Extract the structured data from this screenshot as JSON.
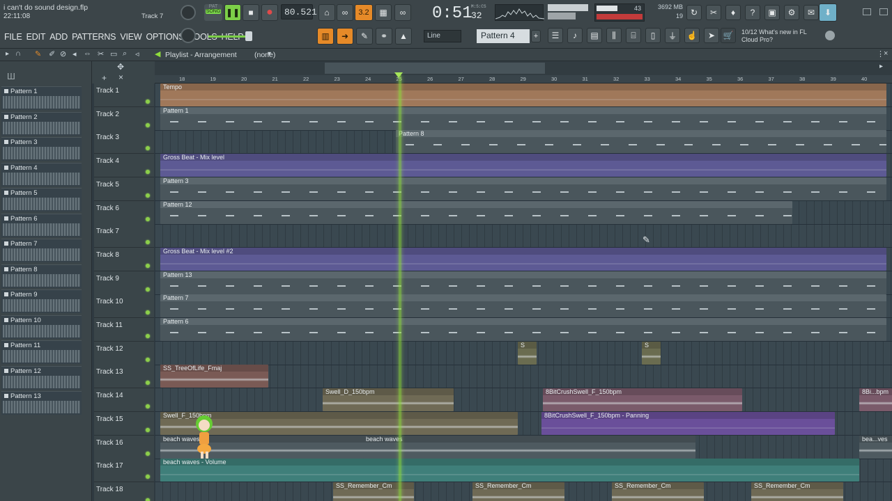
{
  "window": {
    "title": "i can't do sound design.flp",
    "time": "22:11:08",
    "hint_track": "Track 7"
  },
  "transport": {
    "mode": "SONG",
    "pat_label": "PAT",
    "tempo": "80.521",
    "snap": "3.2",
    "song_time": "0:51",
    "song_time_sub": "32",
    "time_unit": "M:S:CS",
    "cpu": "43",
    "ram": "3692 MB",
    "poly": "19"
  },
  "menu": [
    "FILE",
    "EDIT",
    "ADD",
    "PATTERNS",
    "VIEW",
    "OPTIONS",
    "TOOLS",
    "HELP"
  ],
  "toolbar2": {
    "line_mode": "Line",
    "pattern_selector": "Pattern 4",
    "news_count": "10/12",
    "news_text": "What's new in FL Cloud Pro?"
  },
  "playlist": {
    "title": "Playlist - Arrangement",
    "arrangement": "(none)"
  },
  "picker": [
    "Pattern 1",
    "Pattern 2",
    "Pattern 3",
    "Pattern 4",
    "Pattern 5",
    "Pattern 6",
    "Pattern 7",
    "Pattern 8",
    "Pattern 9",
    "Pattern 10",
    "Pattern 11",
    "Pattern 12",
    "Pattern 13"
  ],
  "ruler": [
    "18",
    "19",
    "20",
    "21",
    "22",
    "23",
    "24",
    "25",
    "26",
    "27",
    "28",
    "29",
    "30",
    "31",
    "32",
    "33",
    "34",
    "35",
    "36",
    "37",
    "38",
    "39",
    "40"
  ],
  "tracks": [
    "Track 1",
    "Track 2",
    "Track 3",
    "Track 4",
    "Track 5",
    "Track 6",
    "Track 7",
    "Track 8",
    "Track 9",
    "Track 10",
    "Track 11",
    "Track 12",
    "Track 13",
    "Track 14",
    "Track 15",
    "Track 16",
    "Track 17",
    "Track 18"
  ],
  "clips": [
    {
      "track": 0,
      "label": "Tempo",
      "kind": "auto",
      "color": "#a0785a"
    },
    {
      "track": 1,
      "label": "Pattern 1",
      "kind": "pattern",
      "color": "#5b676d"
    },
    {
      "track": 2,
      "label": "Pattern 8",
      "kind": "pattern",
      "color": "#5b676d"
    },
    {
      "track": 3,
      "label": "Gross Beat - Mix level",
      "kind": "auto",
      "color": "#5d5a94"
    },
    {
      "track": 4,
      "label": "Pattern 3",
      "kind": "pattern",
      "color": "#5b676d"
    },
    {
      "track": 5,
      "label": "Pattern 12",
      "kind": "pattern",
      "color": "#5b676d"
    },
    {
      "track": 7,
      "label": "Gross Beat - Mix level #2",
      "kind": "auto",
      "color": "#5d5a94"
    },
    {
      "track": 8,
      "label": "Pattern 13",
      "kind": "pattern",
      "color": "#5b676d"
    },
    {
      "track": 9,
      "label": "Pattern 7",
      "kind": "pattern",
      "color": "#5b676d"
    },
    {
      "track": 10,
      "label": "Pattern 6",
      "kind": "pattern",
      "color": "#5b676d"
    },
    {
      "track": 11,
      "label": "S",
      "kind": "audio",
      "color": "#6a6c50"
    },
    {
      "track": 11,
      "label": "S",
      "kind": "audio",
      "color": "#6a6c50"
    },
    {
      "track": 12,
      "label": "SS_TreeOfLife_Fmaj",
      "kind": "audio",
      "color": "#7a5a55"
    },
    {
      "track": 13,
      "label": "Swell_D_150bpm",
      "kind": "audio",
      "color": "#6f6a55"
    },
    {
      "track": 13,
      "label": "8BitCrushSwell_F_150bpm",
      "kind": "audio",
      "color": "#7a5a6a"
    },
    {
      "track": 13,
      "label": "8Bi...bpm",
      "kind": "audio",
      "color": "#7a5a6a"
    },
    {
      "track": 14,
      "label": "Swell_F_150bpm",
      "kind": "audio",
      "color": "#6f6a55"
    },
    {
      "track": 14,
      "label": "8BitCrushSwell_F_150bpm - Panning",
      "kind": "auto",
      "color": "#6a4f9a"
    },
    {
      "track": 15,
      "label": "beach waves",
      "kind": "audio",
      "color": "#4e5a60"
    },
    {
      "track": 15,
      "label": "beach waves",
      "kind": "audio",
      "color": "#4e5a60"
    },
    {
      "track": 15,
      "label": "bea...ves",
      "kind": "audio",
      "color": "#4e5a60"
    },
    {
      "track": 16,
      "label": "beach waves - Volume",
      "kind": "auto",
      "color": "#3f7f7a"
    },
    {
      "track": 17,
      "label": "SS_Remember_Cm",
      "kind": "audio",
      "color": "#6f6a55"
    },
    {
      "track": 17,
      "label": "SS_Remember_Cm",
      "kind": "audio",
      "color": "#6f6a55"
    },
    {
      "track": 17,
      "label": "SS_Remember_Cm",
      "kind": "audio",
      "color": "#6f6a55"
    },
    {
      "track": 17,
      "label": "SS_Remember_Cm",
      "kind": "audio",
      "color": "#6f6a55"
    }
  ]
}
